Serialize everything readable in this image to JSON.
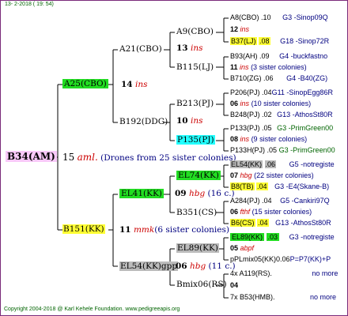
{
  "header": "13- 2-2018 ( 19: 54)",
  "footer": "Copyright 2004-2018 @ Karl Kehele Foundation. www.pedigreeapis.org",
  "root": {
    "id": "B34(AM)",
    "num": "15",
    "ins": "aml.",
    "note": "(Drones from 25 sister colonies)"
  },
  "gen1": [
    {
      "id": "A25(CBO)",
      "num": "14",
      "ins": "ins"
    },
    {
      "id": "B151(KK)",
      "num": "11",
      "ins": "mmk",
      "note": "(6 sister colonies)"
    }
  ],
  "gen2": [
    {
      "id": "A21(CBO)"
    },
    {
      "id": "B192(DDG)"
    },
    {
      "id": "EL41(KK)",
      "num": "09",
      "ins": "hbg",
      "note": "(16 c.)"
    },
    {
      "id": "EL54(KK)gpp",
      "num": "06",
      "ins": "hbg",
      "note": "(11 c.)"
    }
  ],
  "gen3": [
    {
      "id": "A9(CBO)",
      "num": "13",
      "ins": "ins"
    },
    {
      "id": "B115(LJ)"
    },
    {
      "id": "B213(PJ)",
      "num": "10",
      "ins": "ins"
    },
    {
      "id": "P135(PJ)"
    },
    {
      "id": "EL74(KK)",
      "num": "07",
      "ins": "hbg",
      "note": "(22 c.)"
    },
    {
      "id": "B351(CS)"
    },
    {
      "id": "EL89(KK)",
      "num": "05",
      "ins": "abpf"
    },
    {
      "id": "Bmix06(RS)",
      "num": "04"
    }
  ],
  "gen4": [
    {
      "id": "A8(CBO)",
      "num": ".10",
      "ref": "G3 -Sinop09Q"
    },
    {
      "id": "",
      "num": "12",
      "ins": "ins"
    },
    {
      "id": "B37(LJ)",
      "num": ".08",
      "ref": "G18 -Sinop72R"
    },
    {
      "id": "B93(AH)",
      "num": ".09",
      "ref": "G4 -buckfastno"
    },
    {
      "id": "",
      "num": "11",
      "ins": "ins",
      "note": "(3 sister colonies)"
    },
    {
      "id": "B710(ZG)",
      "num": ".06",
      "ref": "G4 -B40(ZG)"
    },
    {
      "id": "P206(PJ)",
      "num": ".04",
      "ref": "G11 -SinopEgg86R"
    },
    {
      "id": "",
      "num": "06",
      "ins": "ins",
      "note": "(10 sister colonies)"
    },
    {
      "id": "B248(PJ)",
      "num": ".02",
      "ref": "G13 -AthosSt80R"
    },
    {
      "id": "P133(PJ)",
      "num": ".05",
      "ref": "G3 -PrimGreen00"
    },
    {
      "id": "",
      "num": "08",
      "ins": "ins",
      "note": "(9 sister colonies)"
    },
    {
      "id": "P133H(PJ)",
      "num": ".05",
      "ref": "G3 -PrimGreen00"
    },
    {
      "id": "EL54(KK)",
      "num": ".06",
      "ref": "G5 -notregiste"
    },
    {
      "id": "",
      "num": "07",
      "ins": "hbg",
      "note": "(22 sister colonies)"
    },
    {
      "id": "B8(TB)",
      "num": ".04",
      "ref": "G3 -E4(Skane-B)"
    },
    {
      "id": "A284(PJ)",
      "num": ".04",
      "ref": "G5 -Cankiri97Q"
    },
    {
      "id": "",
      "num": "06",
      "ins": "fthf",
      "note": "(15 sister colonies)"
    },
    {
      "id": "B6(CS)",
      "num": ".04",
      "ref": "G13 -AthosSt80R"
    },
    {
      "id": "EL89(KK)",
      "num": ".03",
      "ref": "G3 -notregiste"
    },
    {
      "id": "",
      "num": "05",
      "ins": "abpf"
    },
    {
      "id": "pPLmix05(KK)",
      "num": "0.06",
      "ref": "P=P7(KK)+P"
    },
    {
      "id": "4x A119(RS)",
      "num": ".",
      "ref": "no more"
    },
    {
      "id": "",
      "num": "04"
    },
    {
      "id": "7x B53(HMB)",
      "num": ".",
      "ref": "no more"
    }
  ]
}
